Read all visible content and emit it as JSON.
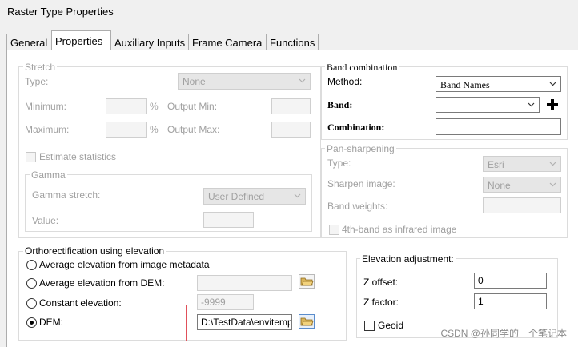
{
  "window": {
    "title": "Raster Type Properties"
  },
  "tabs": [
    "General",
    "Properties",
    "Auxiliary Inputs",
    "Frame Camera",
    "Functions"
  ],
  "stretch": {
    "legend": "Stretch",
    "type_label": "Type:",
    "type_value": "None",
    "min_label": "Minimum:",
    "max_label": "Maximum:",
    "percent": "%",
    "out_min_label": "Output Min:",
    "out_max_label": "Output Max:",
    "estimate_label": "Estimate statistics"
  },
  "gamma": {
    "legend": "Gamma",
    "stretch_label": "Gamma stretch:",
    "stretch_value": "User Defined",
    "value_label": "Value:"
  },
  "band_combination": {
    "legend": "Band combination",
    "method_label": "Method:",
    "method_value": "Band Names",
    "band_label": "Band:",
    "band_value": "",
    "combination_label": "Combination:",
    "combination_value": ""
  },
  "pan": {
    "legend": "Pan-sharpening",
    "type_label": "Type:",
    "type_value": "Esri",
    "sharpen_label": "Sharpen image:",
    "sharpen_value": "None",
    "weights_label": "Band weights:",
    "infrared_label": "4th-band as infrared image"
  },
  "ortho": {
    "legend": "Orthorectification using elevation",
    "opt_metadata": "Average elevation from image metadata",
    "opt_avg_dem": "Average elevation from DEM:",
    "opt_constant": "Constant elevation:",
    "constant_value": "-9999",
    "opt_dem": "DEM:",
    "dem_path": "D:\\TestData\\envitemp\\de"
  },
  "elevation_adj": {
    "legend": "Elevation adjustment:",
    "z_offset_label": "Z offset:",
    "z_offset_value": "0",
    "z_factor_label": "Z factor:",
    "z_factor_value": "1",
    "geoid_label": "Geoid"
  },
  "watermark": "CSDN @孙同学的一个笔记本",
  "icons": {
    "chevron": "chevron-down-icon",
    "add": "plus-icon",
    "folder": "folder-open-icon"
  }
}
